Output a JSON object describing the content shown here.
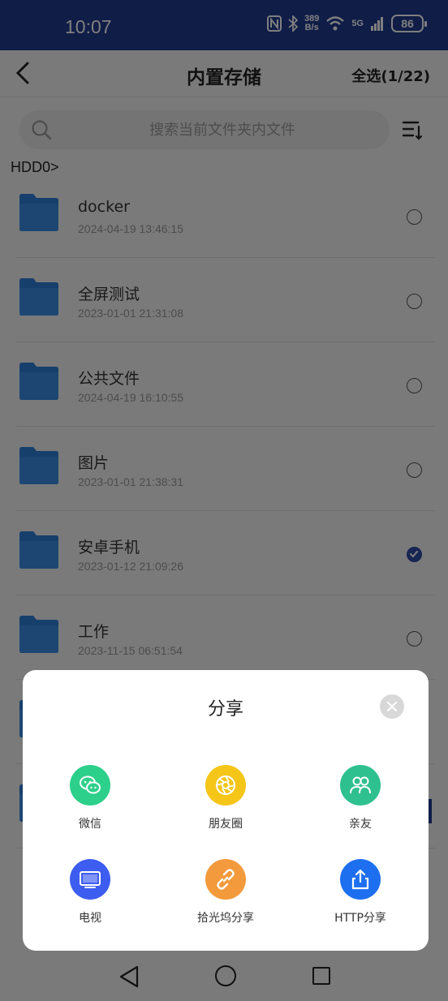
{
  "status_bar": {
    "time": "10:07",
    "net_speed_value": "389",
    "net_speed_unit": "B/s",
    "network": "5G",
    "battery": "86"
  },
  "header": {
    "title": "内置存储",
    "select_all": "全选(1/22)"
  },
  "search": {
    "placeholder": "搜索当前文件夹内文件"
  },
  "breadcrumb": "HDD0>",
  "files": [
    {
      "name": "docker",
      "date": "2024-04-19 13:46:15",
      "selected": false
    },
    {
      "name": "全屏测试",
      "date": "2023-01-01 21:31:08",
      "selected": false
    },
    {
      "name": "公共文件",
      "date": "2024-04-19 16:10:55",
      "selected": false
    },
    {
      "name": "图片",
      "date": "2023-01-01 21:38:31",
      "selected": false
    },
    {
      "name": "安卓手机",
      "date": "2023-01-12 21:09:26",
      "selected": true
    },
    {
      "name": "工作",
      "date": "2023-11-15 06:51:54",
      "selected": false
    }
  ],
  "share_sheet": {
    "title": "分享",
    "items": [
      {
        "label": "微信",
        "icon": "wechat-icon",
        "color": "#2dd08a"
      },
      {
        "label": "朋友圈",
        "icon": "moments-icon",
        "color": "#f5c518"
      },
      {
        "label": "亲友",
        "icon": "family-icon",
        "color": "#2fc08f"
      },
      {
        "label": "电视",
        "icon": "tv-icon",
        "color": "#3d5df0"
      },
      {
        "label": "拾光坞分享",
        "icon": "link-icon",
        "color": "#f39a3c"
      },
      {
        "label": "HTTP分享",
        "icon": "upload-share-icon",
        "color": "#1e6ff0"
      }
    ]
  },
  "colors": {
    "header_blue": "#1f3a8f",
    "selected_radio": "#2e4ba6",
    "folder_blue": "#2f7fd8"
  }
}
